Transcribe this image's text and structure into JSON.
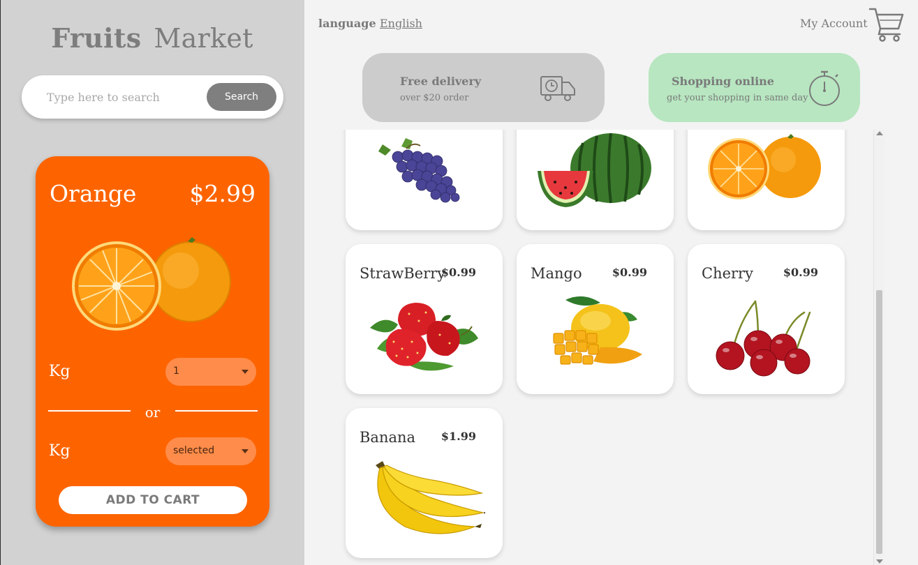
{
  "sidebar": {
    "brand": {
      "part1": "Fruits",
      "part2": "Market"
    },
    "search": {
      "placeholder": "Type here to search",
      "button_label": "Search"
    }
  },
  "detail": {
    "name": "Orange",
    "price": "$2.99",
    "image_icon": "orange-icon",
    "unit_label_1": "Kg",
    "qty_1_value": "1",
    "or_text": "or",
    "unit_label_2": "Kg",
    "qty_2_value": "selected",
    "add_button_label": "ADD TO CART"
  },
  "header": {
    "language_label": "language",
    "language_value": "English",
    "account_label": "My Account",
    "cart_icon": "cart-icon"
  },
  "banners": [
    {
      "title": "Free delivery",
      "subtitle": "over $20 order",
      "icon": "truck-icon"
    },
    {
      "title": "Shopping online",
      "subtitle": "get your shopping in same day",
      "icon": "stopwatch-icon"
    }
  ],
  "products": [
    {
      "name": "",
      "price": "",
      "icon": "grapes-icon"
    },
    {
      "name": "",
      "price": "",
      "icon": "watermelon-icon"
    },
    {
      "name": "",
      "price": "",
      "icon": "orange-icon"
    },
    {
      "name": "StrawBerry",
      "price": "$0.99",
      "icon": "strawberry-icon"
    },
    {
      "name": "Mango",
      "price": "$0.99",
      "icon": "mango-icon"
    },
    {
      "name": "Cherry",
      "price": "$0.99",
      "icon": "cherry-icon"
    },
    {
      "name": "Banana",
      "price": "$1.99",
      "icon": "banana-icon"
    }
  ],
  "colors": {
    "sidebar_bg": "#d2d2d2",
    "detail_bg": "#fd6400",
    "delivery_banner_bg": "#cccccc",
    "shopping_banner_bg": "#b7e6c0",
    "search_button": "#7f7f7f"
  }
}
